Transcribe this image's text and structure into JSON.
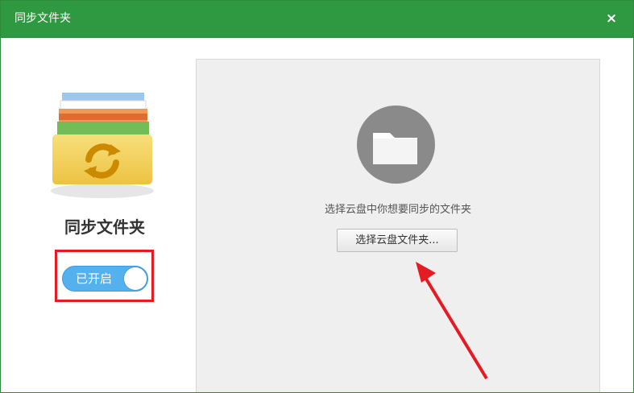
{
  "window": {
    "title": "同步文件夹",
    "close_label": "×"
  },
  "left_panel": {
    "heading": "同步文件夹",
    "toggle": {
      "label": "已开启",
      "state": "on",
      "color": "#55b1ee"
    }
  },
  "right_panel": {
    "hint": "选择云盘中你想要同步的文件夹",
    "choose_button": "选择云盘文件夹..."
  },
  "colors": {
    "titlebar": "#2f9941",
    "highlight": "#e51b24",
    "folder": "#f5d76e"
  },
  "icons": {
    "folder_sync": "folder-sync-icon",
    "empty_folder": "empty-folder-icon",
    "arrow": "red-arrow-annotation"
  }
}
